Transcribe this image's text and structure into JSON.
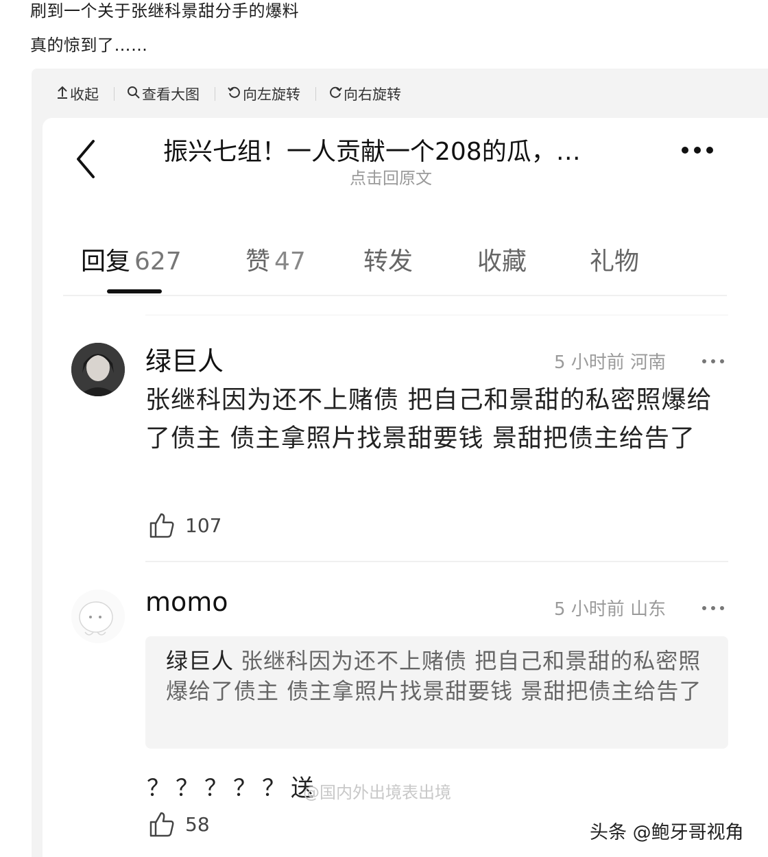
{
  "post": {
    "line1": "刷到一个关于张继科景甜分手的爆料",
    "line2": "真的惊到了……"
  },
  "viewer_toolbar": {
    "collapse": "收起",
    "view_large": "查看大图",
    "rotate_left": "向左旋转",
    "rotate_right": "向右旋转"
  },
  "thread": {
    "title": "振兴七组！一人贡献一个208的瓜，…",
    "subtitle": "点击回原文"
  },
  "tabs": [
    {
      "label": "回复",
      "count": "627"
    },
    {
      "label": "赞",
      "count": "47"
    },
    {
      "label": "转发",
      "count": ""
    },
    {
      "label": "收藏",
      "count": ""
    },
    {
      "label": "礼物",
      "count": ""
    }
  ],
  "comments": [
    {
      "author": "绿巨人",
      "meta": "5 小时前  河南",
      "body": "张继科因为还不上赌债 把自己和景甜的私密照爆给了债主 债主拿照片找景甜要钱 景甜把债主给告了",
      "likes": "107"
    },
    {
      "author": "momo",
      "meta": "5 小时前  山东",
      "quote_author": "绿巨人",
      "quote_text": "张继科因为还不上赌债 把自己和景甜的私密照爆给了债主 债主拿照片找景甜要钱 景甜把债主给告了",
      "body": "？？？？？送",
      "overlay_watermark": "@国内外出境表出境",
      "likes": "58"
    }
  ],
  "watermark": "头条 @鲍牙哥视角",
  "colors": {
    "background": "#ffffff",
    "viewer_bg": "#f3f3f3",
    "meta_text": "#9a9a9a",
    "quote_bg": "#f4f4f4"
  },
  "icons": [
    "upload-icon",
    "magnifier-icon",
    "rotate-left-icon",
    "rotate-right-icon",
    "back-chevron-icon",
    "more-dots-icon",
    "thumbs-up-icon"
  ]
}
